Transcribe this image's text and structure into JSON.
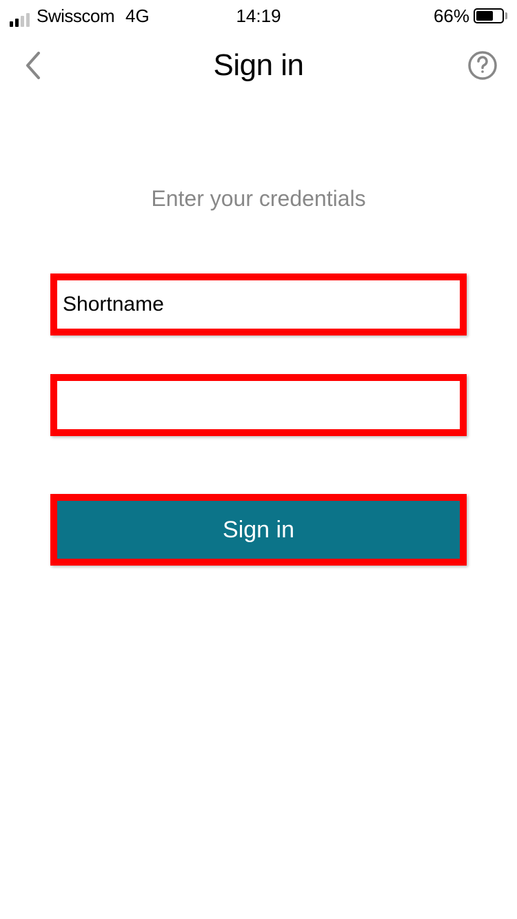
{
  "status": {
    "carrier": "Swisscom",
    "network": "4G",
    "time": "14:19",
    "battery_pct": "66%"
  },
  "nav": {
    "title": "Sign in"
  },
  "form": {
    "subtitle": "Enter your credentials",
    "username_placeholder": "Shortname",
    "username_value": "",
    "password_value": "",
    "submit_label": "Sign in"
  }
}
